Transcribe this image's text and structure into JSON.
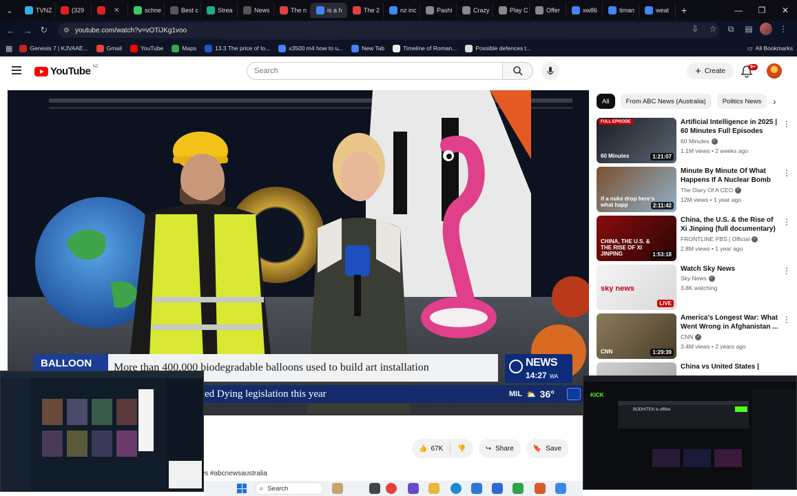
{
  "browser": {
    "tabs": [
      {
        "label": "TVNZ",
        "color": "#2bb3e6"
      },
      {
        "label": "(329",
        "color": "#e02020"
      },
      {
        "label": "",
        "color": "#e02020"
      },
      {
        "label": "schne",
        "color": "#33cc66"
      },
      {
        "label": "Best c",
        "color": "#555555"
      },
      {
        "label": "Strea",
        "color": "#22aa88"
      },
      {
        "label": "News",
        "color": "#555555"
      },
      {
        "label": "The n",
        "color": "#e04040"
      },
      {
        "label": "is a h",
        "color": "#4285f4"
      },
      {
        "label": "The 2",
        "color": "#e04040"
      },
      {
        "label": "nz inc",
        "color": "#4285f4"
      },
      {
        "label": "Pashi",
        "color": "#888888"
      },
      {
        "label": "Crazy",
        "color": "#888888"
      },
      {
        "label": "Play C",
        "color": "#888888"
      },
      {
        "label": "Offer",
        "color": "#888888"
      },
      {
        "label": "xw86",
        "color": "#4285f4"
      },
      {
        "label": "timan",
        "color": "#4285f4"
      },
      {
        "label": "weat",
        "color": "#4285f4"
      }
    ],
    "url": "youtube.com/watch?v=vOTiJKg1voo",
    "bookmarks": [
      {
        "label": "Genesis 7 | KJVAAE...",
        "color": "#cc2222"
      },
      {
        "label": "Gmail",
        "color": "#ea4335"
      },
      {
        "label": "YouTube",
        "color": "#ff0000"
      },
      {
        "label": "Maps",
        "color": "#34a853"
      },
      {
        "label": "13.3 The price of to...",
        "color": "#2255cc"
      },
      {
        "label": "x3500 m4 how to u...",
        "color": "#4285f4"
      },
      {
        "label": "New Tab",
        "color": "#4285f4"
      },
      {
        "label": "Timeline of Roman...",
        "color": "#eeeeee"
      },
      {
        "label": "Possible defences t...",
        "color": "#dddddd"
      }
    ],
    "all_bookmarks": "All Bookmarks"
  },
  "header": {
    "country": "NZ",
    "search_placeholder": "Search",
    "create_label": "Create",
    "notification_count": "9+"
  },
  "video": {
    "tag": "BALLOON",
    "headline": "More than 400,000 biodegradable balloons used to build art installation",
    "network": "NEWS",
    "time": "14:27",
    "time_zone": "WA",
    "ticker": "ed Dying legislation this year",
    "weather_city": "MIL",
    "weather_temp": "36°"
  },
  "actions": {
    "likes": "67K",
    "share": "Share",
    "save": "Save"
  },
  "hashtags": "ws #abcnewsaustralia",
  "chips": [
    "All",
    "From ABC News (Australia)",
    "Politics News"
  ],
  "recommendations": [
    {
      "title": "Artificial Intelligence in 2025 | 60 Minutes Full Episodes",
      "channel": "60 Minutes",
      "meta": "1.1M views • 2 weeks ago",
      "duration": "1:21:07",
      "badge": "FULL EPISODE",
      "thumb_text": "60 Minutes",
      "thumb_colors": [
        "#1a1f26",
        "#5a6470"
      ]
    },
    {
      "title": "Minute By Minute Of What Happens If A Nuclear Bomb ...",
      "channel": "The Diary Of A CEO",
      "meta": "12M views • 1 year ago",
      "duration": "2:11:42",
      "badge": "",
      "thumb_text": "if a nuke drop here's what happ",
      "thumb_colors": [
        "#7a5030",
        "#8fb1c8"
      ]
    },
    {
      "title": "China, the U.S. & the Rise of Xi Jinping (full documentary) | ...",
      "channel": "FRONTLINE PBS | Official",
      "meta": "2.8M views • 1 year ago",
      "duration": "1:53:18",
      "badge": "",
      "thumb_text": "CHINA, THE U.S. & THE RISE OF XI JINPING",
      "thumb_colors": [
        "#8a0c0c",
        "#2a0505"
      ]
    },
    {
      "title": "Watch Sky News",
      "channel": "Sky News",
      "meta": "3.8K watching",
      "duration": "LIVE",
      "badge": "",
      "thumb_text": "sky news",
      "thumb_colors": [
        "#f4f4f4",
        "#d8d8d8"
      ]
    },
    {
      "title": "America's Longest War: What Went Wrong in Afghanistan ...",
      "channel": "CNN",
      "meta": "3.4M views • 2 years ago",
      "duration": "1:29:39",
      "badge": "",
      "thumb_text": "CNN",
      "thumb_colors": [
        "#8a7a5a",
        "#4a3e2a"
      ]
    },
    {
      "title": "China vs United States | Behind the War Drums",
      "channel": "",
      "meta": "",
      "duration": "",
      "badge": "",
      "thumb_text": "",
      "thumb_colors": [
        "#d0d0d0",
        "#a0a0a0"
      ]
    }
  ],
  "pip_right": {
    "brand": "KICK",
    "offline_text": "BODHITEN is offline"
  },
  "taskbar": {
    "search": "Search"
  }
}
